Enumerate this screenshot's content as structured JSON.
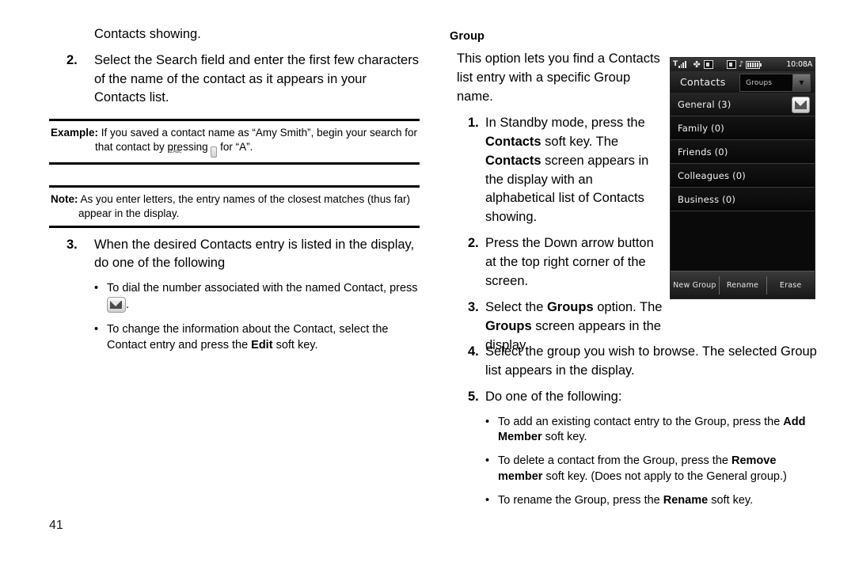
{
  "page_number": "41",
  "left_column": {
    "continued_line": "Contacts showing.",
    "step2": {
      "num": "2.",
      "text": "Select the Search field and enter the first few characters of the name of the contact as it appears in your Contacts list."
    },
    "example_callout": {
      "label": "Example:",
      "text_before_key": "If you saved a contact name as “Amy Smith”, begin your search for that contact by pressing",
      "key_label_main": "2",
      "key_label_sub": "Abc",
      "text_after_key": "for “A”."
    },
    "note_callout": {
      "label": "Note:",
      "text": "As you enter letters, the entry names of the closest matches (thus far) appear in the display."
    },
    "step3": {
      "num": "3.",
      "text": "When the desired Contacts entry is listed in the display, do one of the following",
      "bullets": [
        {
          "dot": "•",
          "text_before_key": "To dial the number associated with the named Contact, press",
          "key_icon": "envelope-key-icon",
          "text_after_key": "."
        },
        {
          "dot": "•",
          "text_part1": "To change the information about the Contact, select the Contact entry and press the ",
          "bold": "Edit",
          "text_part2": " soft key."
        }
      ]
    }
  },
  "right_column": {
    "section_heading": "Group",
    "intro": "This option lets you find a Contacts list entry with a specific Group name.",
    "step1": {
      "num": "1.",
      "part1": "In Standby mode, press the ",
      "bold1": "Contacts",
      "part2": " soft key. The ",
      "bold2": "Contacts",
      "part3": " screen appears in the display with an alphabetical list of Contacts showing."
    },
    "step2": {
      "num": "2.",
      "text": "Press the Down arrow button at the top right corner of the screen."
    },
    "step3": {
      "num": "3.",
      "part1": "Select the ",
      "bold1": "Groups",
      "part2": " option. The ",
      "bold2": "Groups",
      "part3": " screen appears in the display."
    },
    "step4": {
      "num": "4.",
      "text": "Select the group you wish to browse. The selected Group list appears in the display."
    },
    "step5": {
      "num": "5.",
      "text": "Do one of the following:",
      "bullets": [
        {
          "dot": "•",
          "part1": "To add an existing contact entry to the Group, press the ",
          "bold": "Add Member",
          "part2": " soft key."
        },
        {
          "dot": "•",
          "part1": "To delete a contact from the Group, press the ",
          "bold": "Remove member",
          "part2": " soft key. (Does not apply to the General group.)"
        },
        {
          "dot": "•",
          "part1": "To rename the Group, press the ",
          "bold": "Rename",
          "part2": " soft key."
        }
      ]
    }
  },
  "phone_screenshot": {
    "status_bar": {
      "signal_label": "T",
      "icons": [
        "signal-bars-icon",
        "gps-crosshair-icon",
        "roaming-box-icon",
        "bluetooth-box-icon",
        "music-note-icon",
        "battery-icon"
      ],
      "gps_glyph": "✤",
      "music_glyph": "♪",
      "time": "10:08A"
    },
    "title_bar": {
      "title": "Contacts",
      "dropdown_value": "Groups",
      "dropdown_arrow": "▼"
    },
    "list": [
      {
        "label": "General (3)",
        "selected": true,
        "badge": "envelope-icon"
      },
      {
        "label": "Family (0)",
        "selected": false,
        "badge": ""
      },
      {
        "label": "Friends (0)",
        "selected": false,
        "badge": ""
      },
      {
        "label": "Colleagues (0)",
        "selected": false,
        "badge": ""
      },
      {
        "label": "Business (0)",
        "selected": false,
        "badge": ""
      }
    ],
    "soft_keys": [
      "New Group",
      "Rename",
      "Erase"
    ]
  }
}
